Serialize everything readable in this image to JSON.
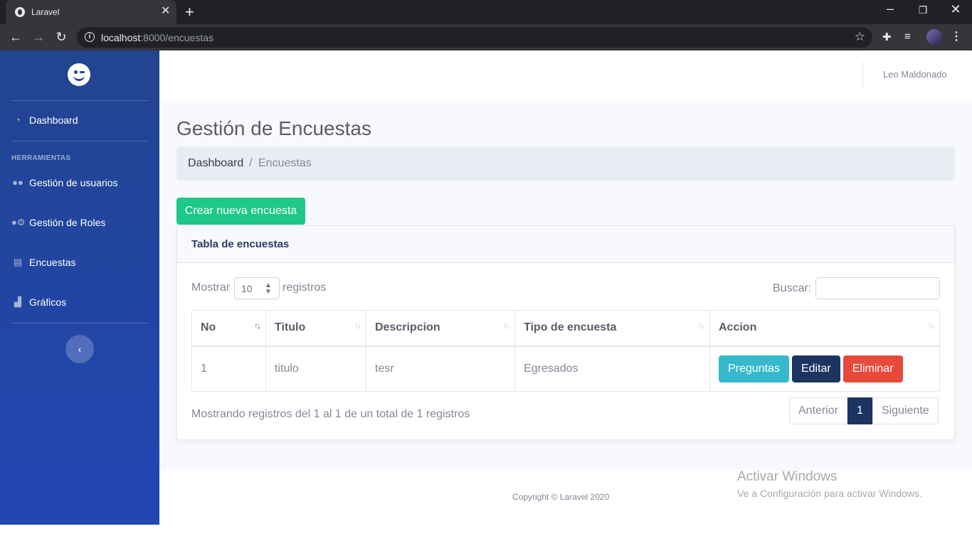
{
  "browser": {
    "tab_title": "Laravel",
    "tab_close": "✕",
    "new_tab": "+",
    "url_host": "localhost",
    "url_rest": ":8000/encuestas"
  },
  "sidebar": {
    "items": [
      {
        "label": "Dashboard",
        "icon": "tachometer-icon"
      },
      {
        "label": "Gestión de usuarios",
        "icon": "users-icon"
      },
      {
        "label": "Gestión de Roles",
        "icon": "users-cog-icon"
      },
      {
        "label": "Encuestas",
        "icon": "file-icon"
      },
      {
        "label": "Gráficos",
        "icon": "chart-area-icon"
      }
    ],
    "heading": "HERRAMIENTAS"
  },
  "topbar": {
    "user_name": "Leo Maldonado"
  },
  "page": {
    "title": "Gestión de Encuestas",
    "breadcrumb": {
      "link": "Dashboard",
      "separator": "/",
      "current": "Encuestas"
    },
    "create_button": "Crear nueva encuesta"
  },
  "card": {
    "title": "Tabla de encuestas",
    "length_pre": "Mostrar",
    "length_value": "10",
    "length_post": "registros",
    "search_label": "Buscar:",
    "search_value": "",
    "columns": [
      "No",
      "Titulo",
      "Descripcion",
      "Tipo de encuesta",
      "Accion"
    ],
    "rows": [
      {
        "no": "1",
        "titulo": "titulo",
        "descripcion": "tesr",
        "tipo": "Egresados"
      }
    ],
    "actions": {
      "preguntas": "Preguntas",
      "editar": "Editar",
      "eliminar": "Eliminar"
    },
    "info": "Mostrando registros del 1 al 1 de un total de 1 registros",
    "pagination": {
      "prev": "Anterior",
      "current": "1",
      "next": "Siguiente"
    }
  },
  "footer": {
    "copyright": "Copyright © Laravel 2020"
  },
  "watermark": {
    "title": "Activar Windows",
    "subtitle": "Ve a Configuración para activar Windows."
  },
  "colors": {
    "sidebar": "#23448f",
    "success": "#1cc88a",
    "info": "#36b9cc",
    "primary_dark": "#1c3461",
    "danger": "#e74a3b"
  }
}
